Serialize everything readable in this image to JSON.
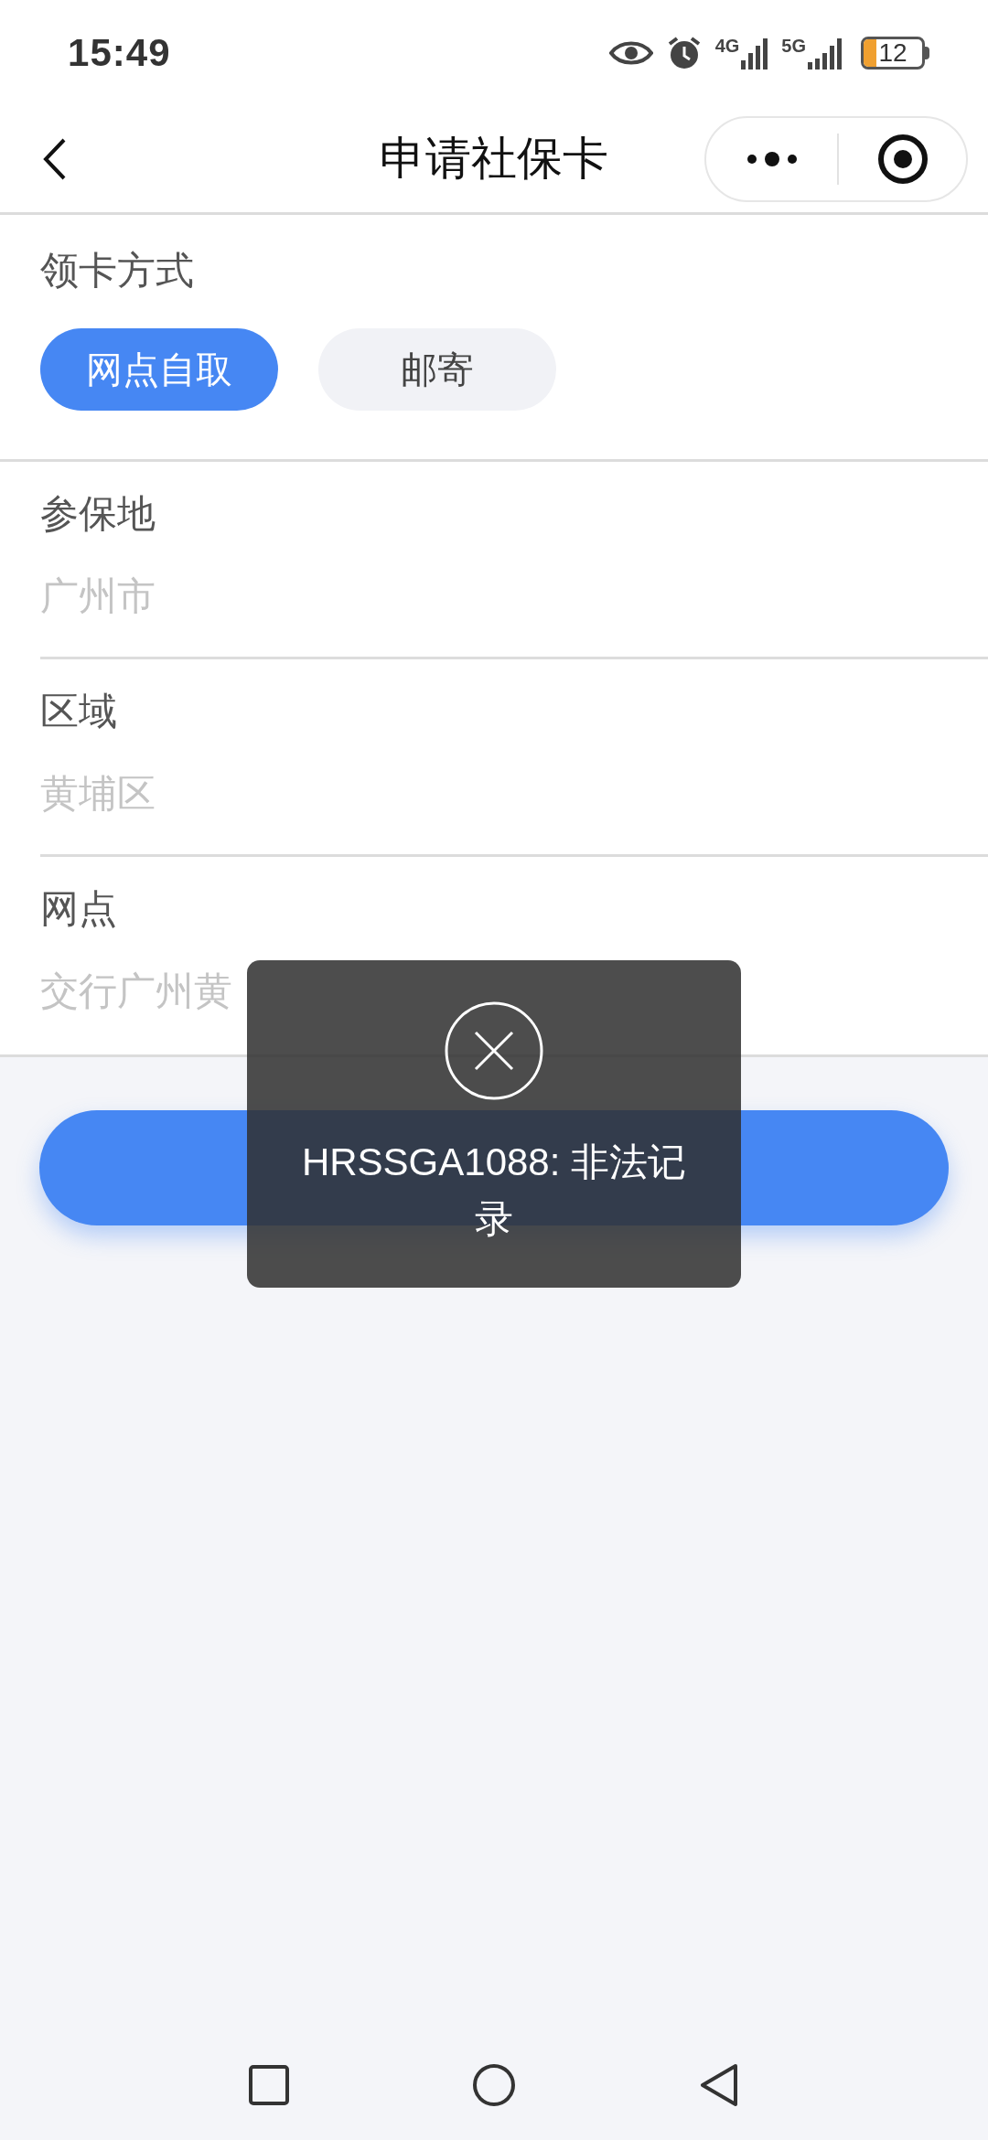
{
  "status_bar": {
    "time": "15:49",
    "network_1": "4G",
    "network_2": "5G",
    "battery": "12"
  },
  "nav": {
    "title": "申请社保卡"
  },
  "pickup": {
    "label": "领卡方式",
    "options": [
      {
        "label": "网点自取",
        "selected": true
      },
      {
        "label": "邮寄",
        "selected": false
      }
    ]
  },
  "fields": [
    {
      "label": "参保地",
      "value": "广州市"
    },
    {
      "label": "区域",
      "value": "黄埔区"
    },
    {
      "label": "网点",
      "value": "交行广州黄"
    }
  ],
  "toast": {
    "message": "HRSSGA1088: 非法记录"
  }
}
